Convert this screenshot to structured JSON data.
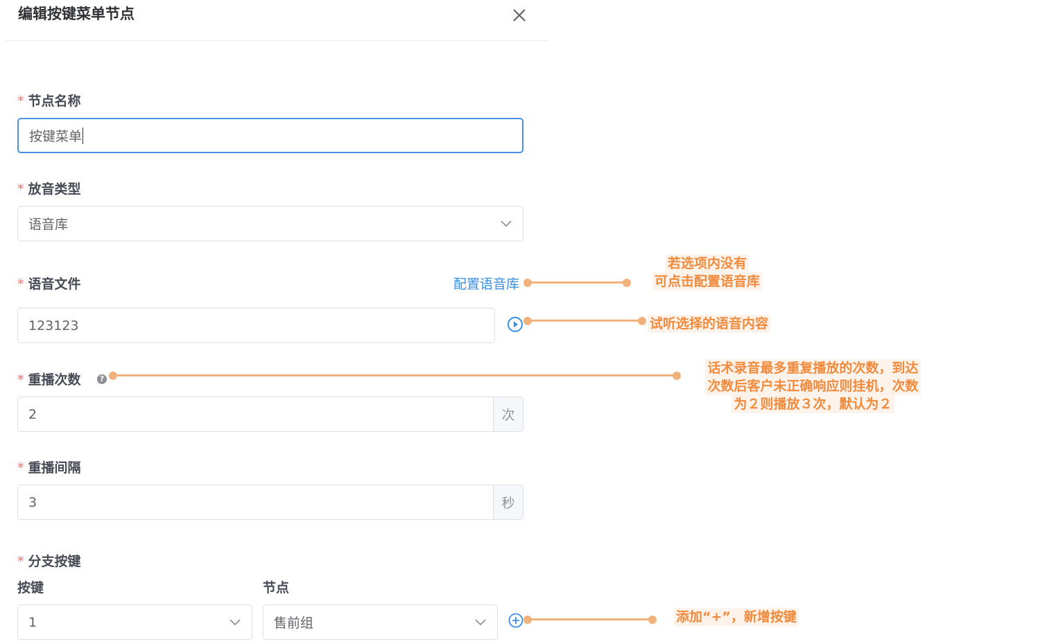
{
  "dialog": {
    "title": "编辑按键菜单节点"
  },
  "form": {
    "node_name": {
      "label": "节点名称",
      "value": "按键菜单"
    },
    "play_type": {
      "label": "放音类型",
      "value": "语音库"
    },
    "voice_file": {
      "label": "语音文件",
      "link": "配置语音库",
      "value": "123123"
    },
    "replay_count": {
      "label": "重播次数",
      "value": "2",
      "unit": "次"
    },
    "replay_interval": {
      "label": "重播间隔",
      "value": "3",
      "unit": "秒"
    },
    "branch_keys": {
      "label": "分支按键",
      "key_column": "按键",
      "node_column": "节点",
      "rows": [
        {
          "key": "1",
          "node": "售前组"
        }
      ]
    }
  },
  "annotations": {
    "voice_library": [
      "若选项内没有",
      "可点击配置语音库"
    ],
    "preview": [
      "试听选择的语音内容"
    ],
    "replay_count": [
      "话术录音最多重复播放的次数，到达",
      "次数后客户未正确响应则挂机，次数",
      "为２则播放３次，默认为２"
    ],
    "add_key": [
      "添加“+”，新增按键"
    ]
  },
  "colors": {
    "required": "#f56c6c",
    "link": "#3a8ee6",
    "focus_border": "#4a90e2",
    "annotation_text": "#f08a3c",
    "annotation_line": "#f0b17c"
  }
}
